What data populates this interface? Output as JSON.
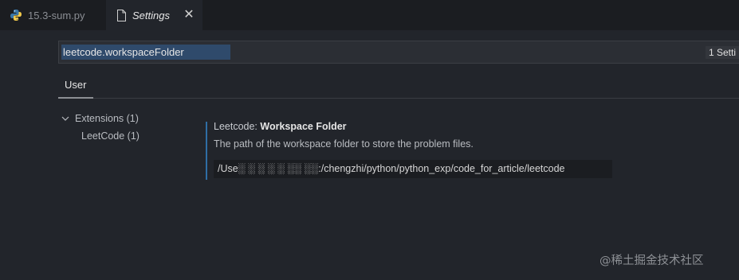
{
  "tabs": [
    {
      "label": "15.3-sum.py",
      "icon": "python-icon"
    },
    {
      "label": "Settings",
      "icon": "file-icon",
      "active": true
    }
  ],
  "search": {
    "value": "leetcode.workspaceFolder",
    "result_count": "1 Setti"
  },
  "scope": {
    "tab": "User"
  },
  "toc": {
    "extensions": "Extensions (1)",
    "leetcode": "LeetCode (1)"
  },
  "setting": {
    "category": "Leetcode: ",
    "name": "Workspace Folder",
    "description": "The path of the workspace folder to store the problem files.",
    "value": "/Use░ ░ ░ ░ ░ ░░ ░░:/chengzhi/python/python_exp/code_for_article/leetcode"
  },
  "watermark": "@稀土掘金技术社区",
  "colors": {
    "accent": "#2f6ea5",
    "background": "#22252b",
    "selection": "#2f4a6b"
  }
}
